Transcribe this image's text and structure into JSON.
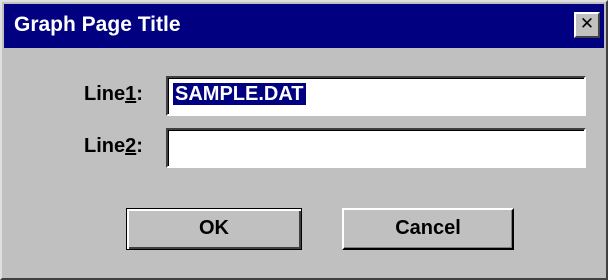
{
  "window": {
    "title": "Graph Page Title",
    "close_glyph": "✕"
  },
  "form": {
    "line1": {
      "label_prefix": "Line",
      "label_mnemonic": "1",
      "label_suffix": ":",
      "value": "SAMPLE.DAT"
    },
    "line2": {
      "label_prefix": "Line",
      "label_mnemonic": "2",
      "label_suffix": ":",
      "value": ""
    }
  },
  "buttons": {
    "ok_label": "OK",
    "cancel_label": "Cancel"
  },
  "icons": {
    "close": "close-icon"
  },
  "colors": {
    "titlebar": "#000080",
    "face": "#c0c0c0",
    "selection": "#000080"
  }
}
